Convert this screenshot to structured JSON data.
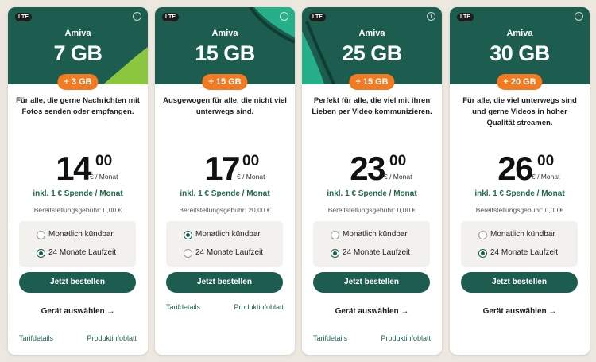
{
  "cards": [
    {
      "badge": "LTE",
      "brand": "Amiva",
      "data_volume": "7 GB",
      "bonus": "+ 3 GB",
      "description": "Für alle, die gerne Nachrichten mit Fotos senden oder empfangen.",
      "price_int": "14",
      "price_dec": "00",
      "price_unit": "€ / Monat",
      "donation": "inkl. 1 € Spende / Monat",
      "setup_fee": "Bereitstellungsgebühr: 0,00 €",
      "options": [
        {
          "label": "Monatlich kündbar",
          "selected": false
        },
        {
          "label": "24 Monate Laufzeit",
          "selected": true
        }
      ],
      "order_label": "Jetzt bestellen",
      "device_label": "Gerät auswählen →",
      "link_details": "Tarifdetails",
      "link_info": "Produktinfoblatt"
    },
    {
      "badge": "LTE",
      "brand": "Amiva",
      "data_volume": "15 GB",
      "bonus": "+ 15 GB",
      "description": "Ausgewogen für alle, die nicht viel unterwegs sind.",
      "price_int": "17",
      "price_dec": "00",
      "price_unit": "€ / Monat",
      "donation": "inkl. 1 € Spende / Monat",
      "setup_fee": "Bereitstellungsgebühr: 20,00 €",
      "options": [
        {
          "label": "Monatlich kündbar",
          "selected": true
        },
        {
          "label": "24 Monate Laufzeit",
          "selected": false
        }
      ],
      "order_label": "Jetzt bestellen",
      "device_label": "",
      "link_details": "Tarifdetails",
      "link_info": "Produktinfoblatt"
    },
    {
      "badge": "LTE",
      "brand": "Amiva",
      "data_volume": "25 GB",
      "bonus": "+ 15 GB",
      "description": "Perfekt für alle, die viel mit ihren Lieben per Video kommunizieren.",
      "price_int": "23",
      "price_dec": "00",
      "price_unit": "€ / Monat",
      "donation": "inkl. 1 € Spende / Monat",
      "setup_fee": "Bereitstellungsgebühr: 0,00 €",
      "options": [
        {
          "label": "Monatlich kündbar",
          "selected": false
        },
        {
          "label": "24 Monate Laufzeit",
          "selected": true
        }
      ],
      "order_label": "Jetzt bestellen",
      "device_label": "Gerät auswählen →",
      "link_details": "Tarifdetails",
      "link_info": "Produktinfoblatt"
    },
    {
      "badge": "LTE",
      "brand": "Amiva",
      "data_volume": "30 GB",
      "bonus": "+ 20 GB",
      "description": "Für alle, die viel unterwegs sind und gerne Videos in hoher Qualität streamen.",
      "price_int": "26",
      "price_dec": "00",
      "price_unit": "€ / Monat",
      "donation": "inkl. 1 € Spende / Monat",
      "setup_fee": "Bereitstellungsgebühr: 0,00 €",
      "options": [
        {
          "label": "Monatlich kündbar",
          "selected": false
        },
        {
          "label": "24 Monate Laufzeit",
          "selected": true
        }
      ],
      "order_label": "Jetzt bestellen",
      "device_label": "Gerät auswählen →",
      "link_details": "",
      "link_info": ""
    }
  ],
  "colors": {
    "header_green": "#1d5d4f",
    "accent_orange": "#f47a20",
    "donation_green": "#1d6b46",
    "deco_light_green": "#8cc63f",
    "deco_teal": "#26b08a"
  },
  "icons": [
    "info-icon",
    "radio-icon",
    "arrow-right-icon"
  ]
}
